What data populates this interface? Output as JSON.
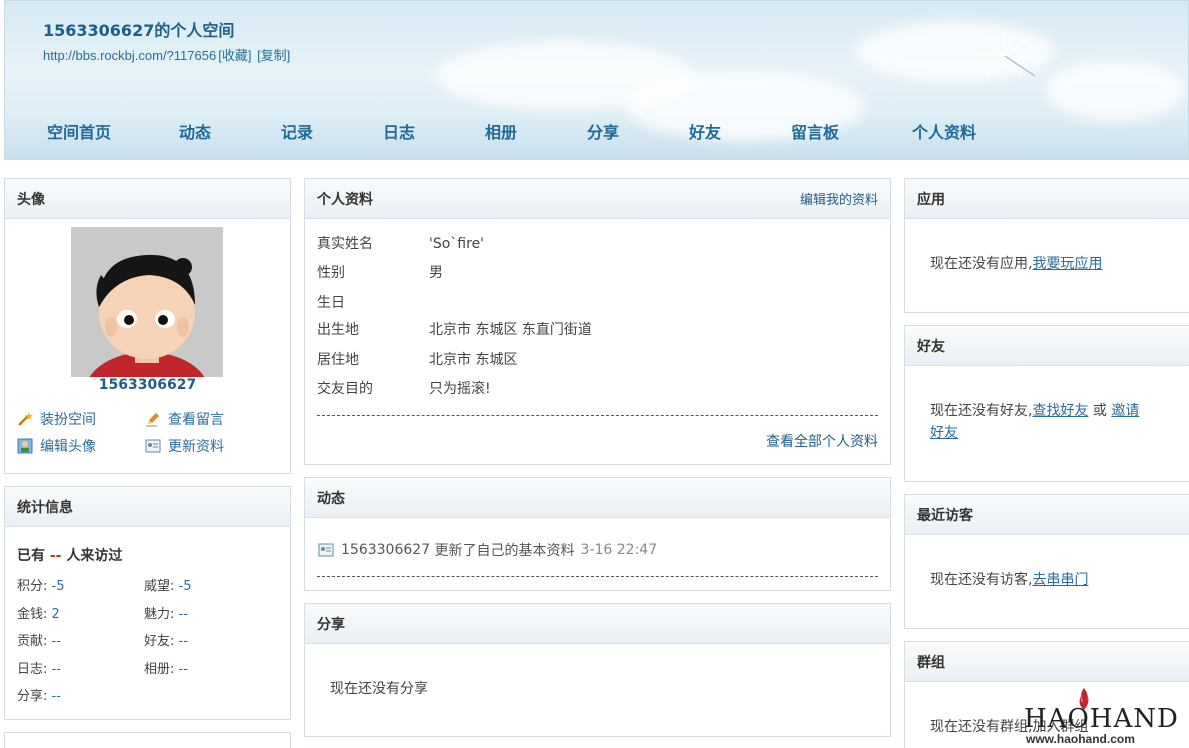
{
  "header": {
    "title": "1563306627的个人空间",
    "url": "http://bbs.rockbj.com/?117656",
    "bookmark": "[收藏]",
    "copy": "[复制]"
  },
  "nav": [
    {
      "label": "空间首页"
    },
    {
      "label": "动态"
    },
    {
      "label": "记录"
    },
    {
      "label": "日志"
    },
    {
      "label": "相册"
    },
    {
      "label": "分享"
    },
    {
      "label": "好友"
    },
    {
      "label": "留言板"
    },
    {
      "label": "个人资料"
    }
  ],
  "avatar_panel": {
    "title": "头像",
    "username": "1563306627",
    "actions": [
      {
        "label": "装扮空间",
        "icon": "magic-wand-icon"
      },
      {
        "label": "查看留言",
        "icon": "pencil-icon"
      },
      {
        "label": "编辑头像",
        "icon": "avatar-edit-icon"
      },
      {
        "label": "更新资料",
        "icon": "profile-card-icon"
      }
    ]
  },
  "stats_panel": {
    "title": "统计信息",
    "visit_prefix": "已有",
    "visit_count": "--",
    "visit_suffix": "人来访过",
    "items": [
      {
        "label": "积分:",
        "value": "-5"
      },
      {
        "label": "威望:",
        "value": "-5"
      },
      {
        "label": "金钱:",
        "value": "2"
      },
      {
        "label": "魅力:",
        "value": "--"
      },
      {
        "label": "贡献:",
        "value": "--"
      },
      {
        "label": "好友:",
        "value": "--"
      },
      {
        "label": "日志:",
        "value": "--"
      },
      {
        "label": "相册:",
        "value": "--"
      },
      {
        "label": "分享:",
        "value": "--"
      }
    ]
  },
  "profile_panel": {
    "title": "个人资料",
    "edit_link": "编辑我的资料",
    "rows": [
      {
        "label": "真实姓名",
        "value": "'So`fire'"
      },
      {
        "label": "性别",
        "value": "男"
      },
      {
        "label": "生日",
        "value": ""
      },
      {
        "label": "出生地",
        "value": "北京市 东城区 东直门街道"
      },
      {
        "label": "居住地",
        "value": "北京市 东城区"
      },
      {
        "label": "交友目的",
        "value": "只为摇滚!"
      }
    ],
    "view_all": "查看全部个人资料"
  },
  "feed_panel": {
    "title": "动态",
    "entry_user": "1563306627",
    "entry_text": "更新了自己的基本资料",
    "entry_time": "3-16 22:47"
  },
  "share_panel": {
    "title": "分享",
    "empty": "现在还没有分享"
  },
  "apps_panel": {
    "title": "应用",
    "empty": "现在还没有应用,",
    "link": "我要玩应用"
  },
  "friends_panel": {
    "title": "好友",
    "empty": "现在还没有好友,",
    "link1": "查找好友",
    "or": "或",
    "link2a": "邀请",
    "link2b": "好友"
  },
  "visitors_panel": {
    "title": "最近访客",
    "empty": "现在还没有访客,",
    "link": "去串串门"
  },
  "groups_panel": {
    "title": "群组",
    "empty": "现在还没有群组,加入群组"
  },
  "watermark": {
    "brand": "HAOHAND",
    "site": "www.haohand.com"
  },
  "colors": {
    "link": "#2a6d99",
    "title": "#1f5f87"
  }
}
